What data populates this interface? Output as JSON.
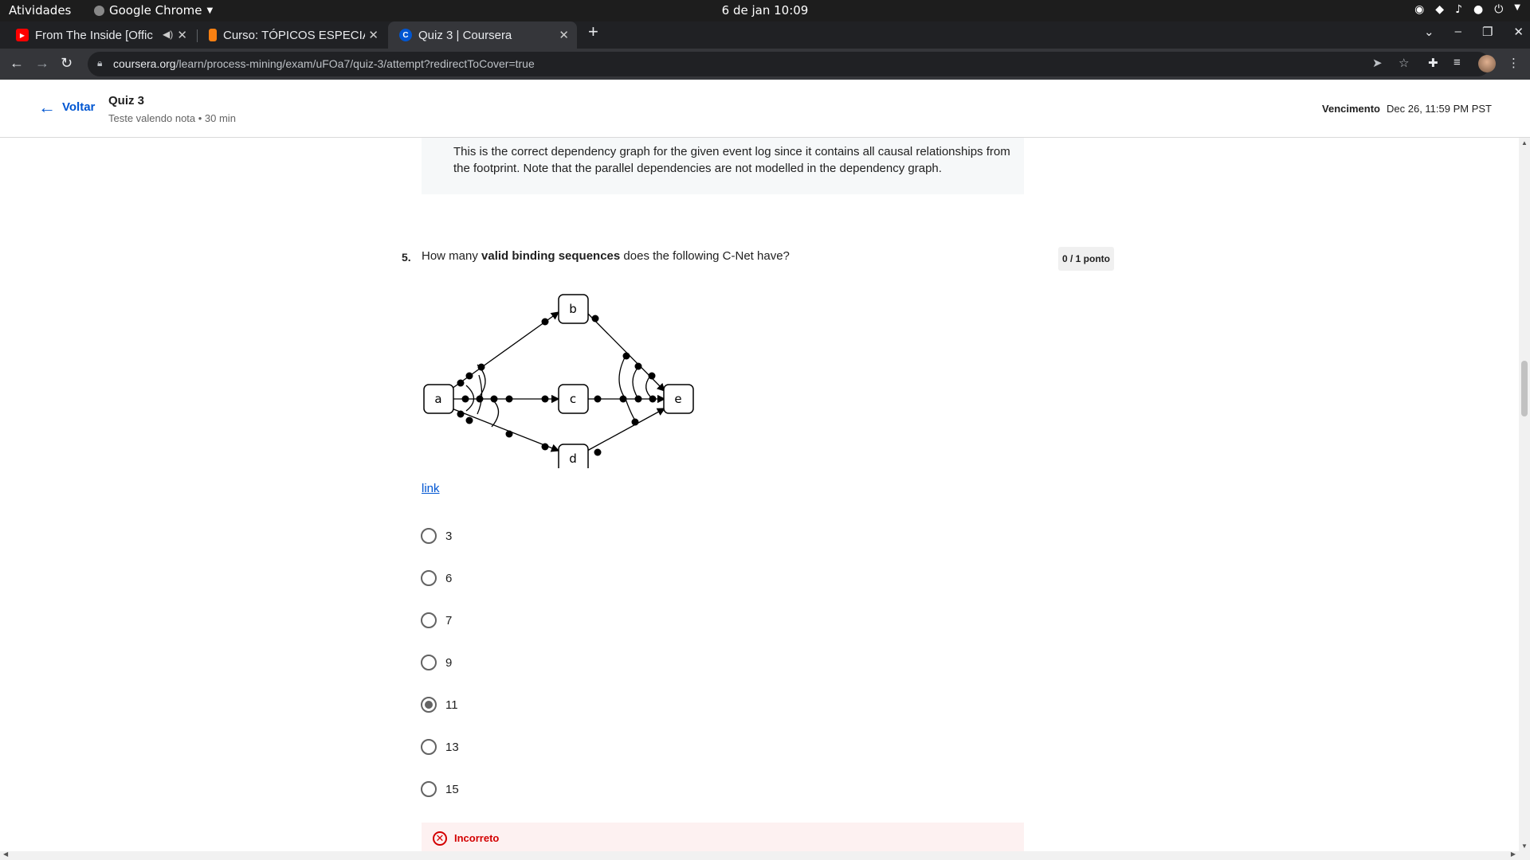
{
  "os": {
    "activities": "Atividades",
    "app_name": "Google Chrome",
    "clock": "6 de jan  10:09"
  },
  "tabs": [
    {
      "title": "From The Inside [Offic",
      "favicon": "youtube-icon",
      "muted_icon": "speaker-icon"
    },
    {
      "title": "Curso: TÓPICOS ESPECIAI",
      "favicon": "moodle-icon"
    },
    {
      "title": "Quiz 3 | Coursera",
      "favicon": "coursera-icon",
      "active": true
    }
  ],
  "browser": {
    "url_host": "coursera.org",
    "url_path": "/learn/process-mining/exam/uFOa7/quiz-3/attempt?redirectToCover=true"
  },
  "header": {
    "back_label": "Voltar",
    "quiz_title": "Quiz 3",
    "quiz_subtitle": "Teste valendo nota • 30 min",
    "due_label": "Vencimento",
    "due_value": "Dec 26, 11:59 PM PST"
  },
  "prev_feedback": "This is the correct dependency graph for the given event log since it contains all causal relationships from the footprint. Note that the parallel dependencies are not modelled in the dependency graph.",
  "question": {
    "number": "5.",
    "text_before": "How many ",
    "text_bold": "valid binding sequences",
    "text_after": " does the following C-Net have?",
    "points": "0 / 1 ponto",
    "link_label": "link",
    "diagram_nodes": [
      "a",
      "b",
      "c",
      "d",
      "e"
    ],
    "options": [
      {
        "label": "3",
        "selected": false
      },
      {
        "label": "6",
        "selected": false
      },
      {
        "label": "7",
        "selected": false
      },
      {
        "label": "9",
        "selected": false
      },
      {
        "label": "11",
        "selected": true
      },
      {
        "label": "13",
        "selected": false
      },
      {
        "label": "15",
        "selected": false
      }
    ],
    "result": "Incorreto"
  },
  "colors": {
    "accent": "#0056d2",
    "error": "#d30001",
    "chrome_dark": "#202124"
  }
}
